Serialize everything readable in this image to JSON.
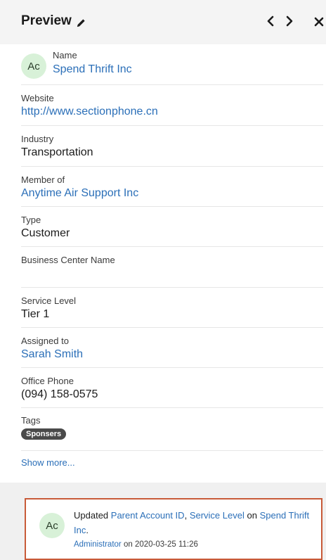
{
  "header": {
    "title": "Preview",
    "edit_icon": "pencil-icon",
    "prev_icon": "chevron-left-icon",
    "next_icon": "chevron-right-icon",
    "close_icon": "close-icon"
  },
  "record": {
    "avatar": "Ac",
    "name_label": "Name",
    "name_value": "Spend Thrift Inc",
    "website_label": "Website",
    "website_value": "http://www.sectionphone.cn",
    "industry_label": "Industry",
    "industry_value": "Transportation",
    "member_of_label": "Member of",
    "member_of_value": "Anytime Air Support Inc",
    "type_label": "Type",
    "type_value": "Customer",
    "business_center_label": "Business Center Name",
    "business_center_value": "",
    "service_level_label": "Service Level",
    "service_level_value": "Tier 1",
    "assigned_to_label": "Assigned to",
    "assigned_to_value": "Sarah Smith",
    "office_phone_label": "Office Phone",
    "office_phone_value": "(094) 158-0575",
    "tags_label": "Tags",
    "tags": [
      "Sponsers"
    ],
    "show_more": "Show more..."
  },
  "activity": {
    "avatar": "Ac",
    "prefix": "Updated",
    "field1": "Parent Account ID",
    "sep": ",",
    "field2": "Service Level",
    "on": "on",
    "target": "Spend Thrift Inc",
    "period": ".",
    "author": "Administrator",
    "on_word": "on",
    "timestamp": "2020-03-25 11:26"
  },
  "colors": {
    "link": "#2b6fb8",
    "highlight_border": "#c85a38",
    "avatar_bg": "#d8f1d8",
    "tag_bg": "#4a4a4a"
  }
}
